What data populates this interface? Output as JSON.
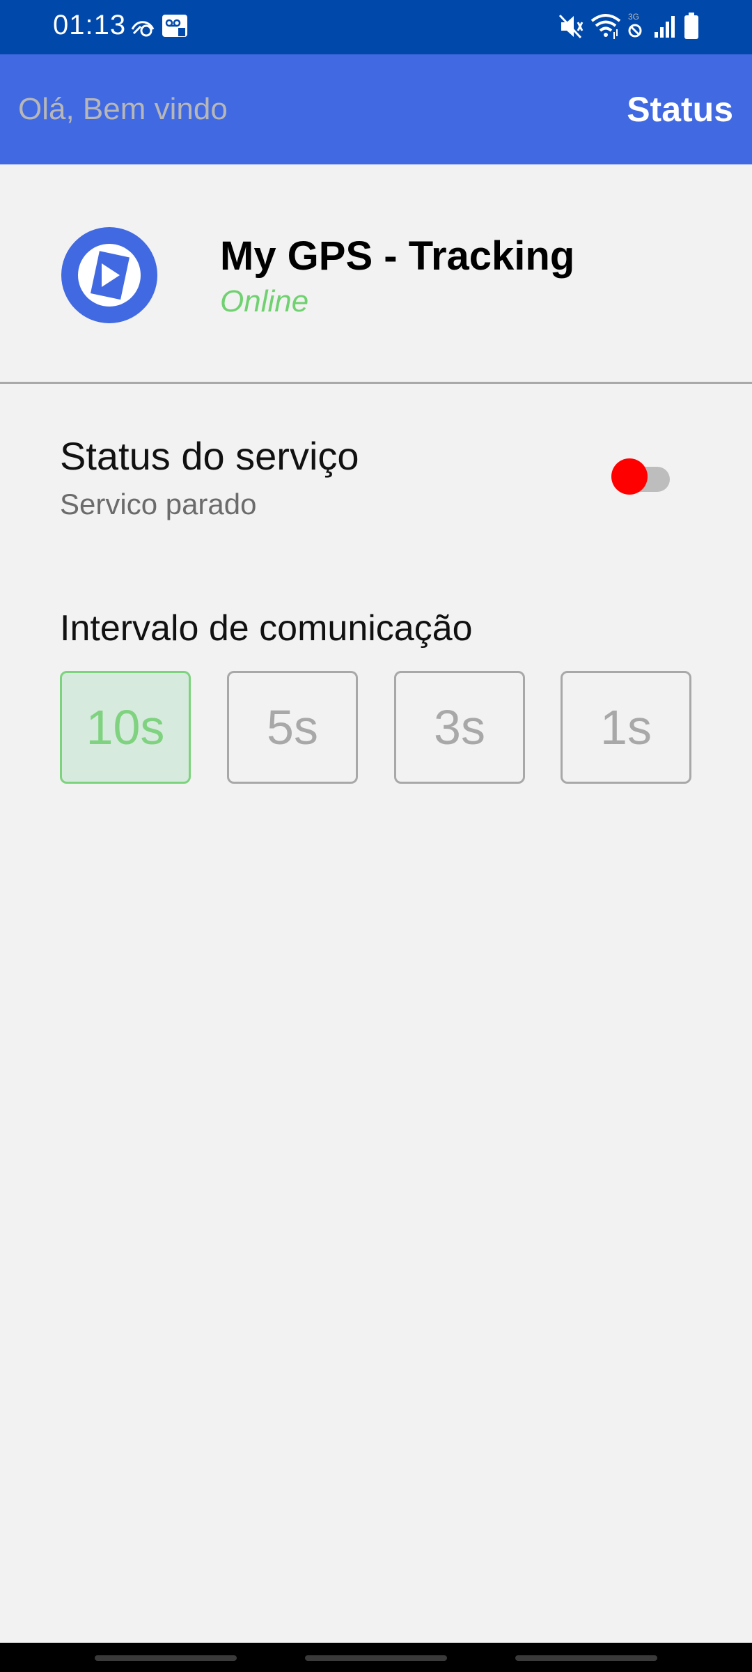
{
  "status_bar": {
    "time": "01:13",
    "icons": [
      "notification-icon",
      "voicemail-icon",
      "mute-icon",
      "wifi-icon",
      "data-saver-icon",
      "signal-icon",
      "battery-icon"
    ]
  },
  "app_bar": {
    "greeting": "Olá, Bem vindo",
    "title": "Status",
    "background": "#4169e1"
  },
  "header": {
    "app_name": "My GPS - Tracking",
    "connection_status": "Online",
    "logo_icon": "play-location-icon"
  },
  "service": {
    "title": "Status do serviço",
    "subtitle": "Servico parado",
    "toggle_on": false
  },
  "interval": {
    "title": "Intervalo de comunicação",
    "options": [
      "10s",
      "5s",
      "3s",
      "1s"
    ],
    "selected": "10s"
  },
  "colors": {
    "accent": "#4169e1",
    "online": "#6fd16f",
    "toggle_off": "#ff0000",
    "selected_border": "#7dd37d"
  }
}
